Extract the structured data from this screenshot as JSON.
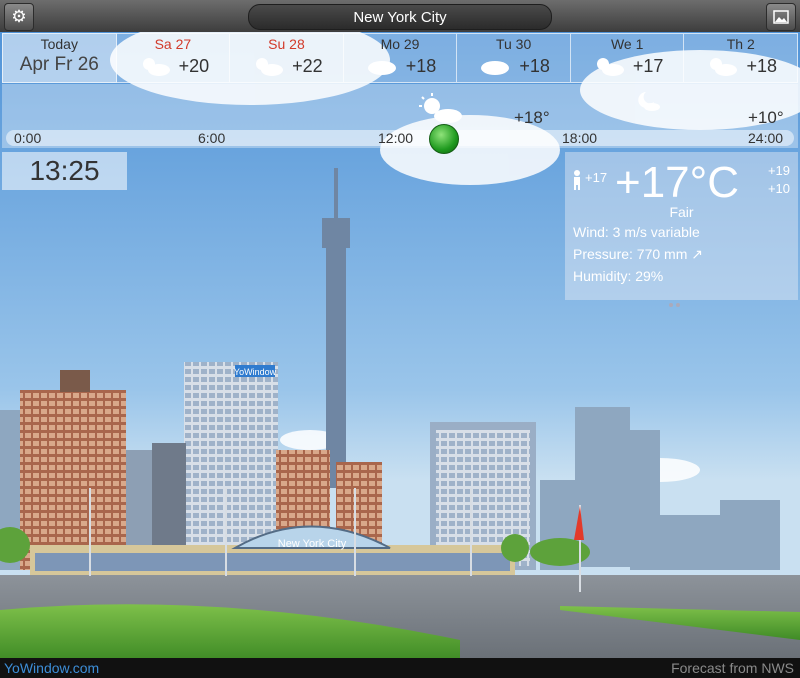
{
  "app": {
    "city": "New York City",
    "brand_sign": "YoWindow",
    "station_sign": "New York City"
  },
  "toolbar": {
    "settings_icon": "gear-icon",
    "gallery_icon": "picture-icon"
  },
  "forecast": [
    {
      "name": "Today",
      "date": "Apr Fr 26",
      "is_today": true
    },
    {
      "name": "Sa 27",
      "temp": "+20",
      "weekend": true,
      "icon": "sun-cloud-icon"
    },
    {
      "name": "Su 28",
      "temp": "+22",
      "weekend": true,
      "icon": "sun-cloud-icon"
    },
    {
      "name": "Mo 29",
      "temp": "+18",
      "weekend": false,
      "icon": "cloud-icon"
    },
    {
      "name": "Tu 30",
      "temp": "+18",
      "weekend": false,
      "icon": "cloud-icon"
    },
    {
      "name": "We 1",
      "temp": "+17",
      "weekend": false,
      "icon": "sun-cloud-icon"
    },
    {
      "name": "Th 2",
      "temp": "+18",
      "weekend": false,
      "icon": "sun-cloud-icon"
    }
  ],
  "hourly": {
    "labels": [
      "0:00",
      "6:00",
      "12:00",
      "18:00",
      "24:00"
    ],
    "temp_day": "+18°",
    "temp_night": "+10°"
  },
  "clock": "13:25",
  "current": {
    "feels_like": "+17",
    "temp": "+17°C",
    "high": "+19",
    "low": "+10",
    "condition": "Fair",
    "wind": "Wind:  3 m/s variable",
    "pressure": "Pressure: 770 mm",
    "humidity": "Humidity:  29%"
  },
  "footer": {
    "left": "YoWindow.com",
    "right": "Forecast from NWS"
  },
  "colors": {
    "sky_top": "#4a8fd6",
    "sky_bottom": "#bcd9ef",
    "weekend": "#d23a2a",
    "link": "#3d8ed8"
  }
}
